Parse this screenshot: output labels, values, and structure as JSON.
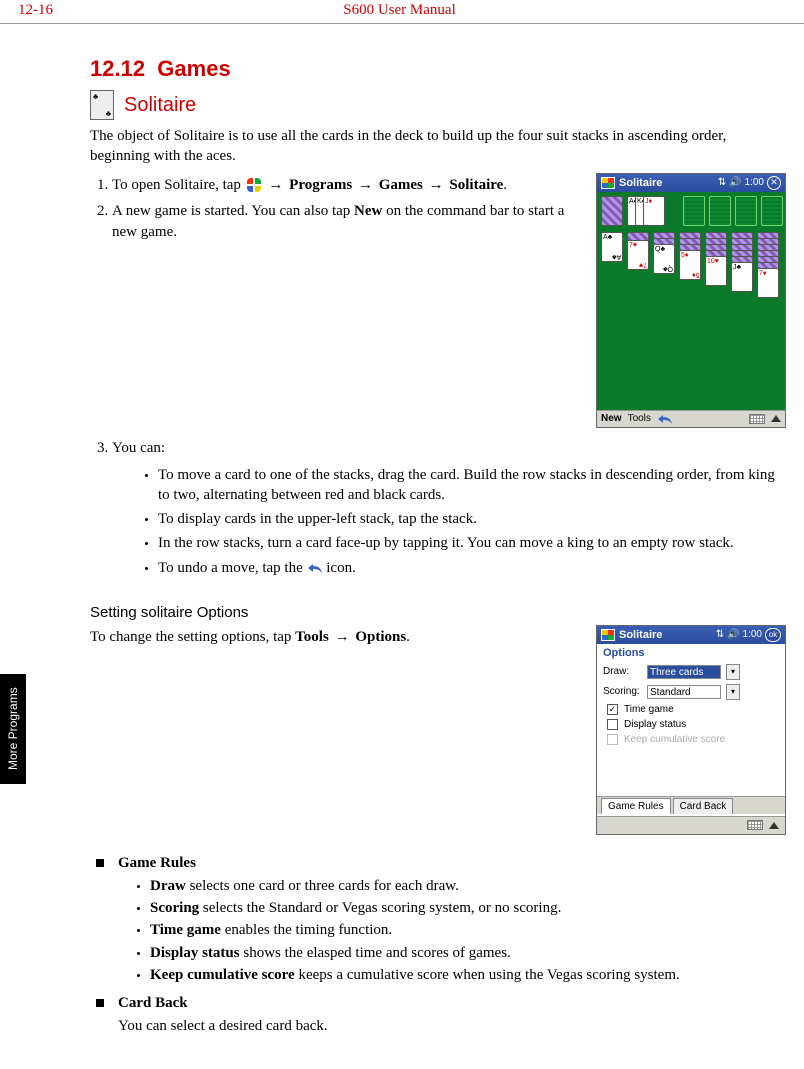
{
  "header": {
    "page_num": "12-16",
    "manual": "S600 User Manual"
  },
  "side_tab": "More Programs",
  "section_number": "12.12",
  "section_title": "Games",
  "game_title": "Solitaire",
  "intro": "The object of Solitaire is to use all the cards in the deck to build up the four suit stacks in ascending order, beginning with the aces.",
  "steps": {
    "s1a": "To open Solitaire, tap ",
    "s1_arrow": "→",
    "s1_b": "Programs",
    "s1_c": "Games",
    "s1_d": "Solitaire",
    "s2a": "A new game is started. You can also tap ",
    "s2_new": "New",
    "s2b": " on the command bar to start a new game.",
    "s3": "You can:",
    "s3_items": [
      "To move a card to one of the stacks, drag the card. Build the row stacks in descending order, from king to two, alternating between red and black cards.",
      "To display cards in the upper-left stack, tap the stack.",
      "In the row stacks, turn a card face-up by tapping it. You can move a king to an empty row stack."
    ],
    "s3_undo_a": "To undo a move, tap the ",
    "s3_undo_b": " icon."
  },
  "screenshot1": {
    "title": "Solitaire",
    "time": "1:00",
    "menu_new": "New",
    "menu_tools": "Tools"
  },
  "options_heading": "Setting solitaire Options",
  "options_intro_a": "To change the setting options, tap ",
  "options_intro_tools": "Tools",
  "options_intro_arrow": "→",
  "options_intro_options": "Options",
  "options_intro_end": ".",
  "screenshot2": {
    "title": "Solitaire",
    "time": "1:00",
    "ok": "ok",
    "subtitle": "Options",
    "draw_label": "Draw:",
    "draw_value": "Three cards",
    "scoring_label": "Scoring:",
    "scoring_value": "Standard",
    "chk_time": "Time game",
    "chk_display": "Display status",
    "chk_keep": "Keep cumulative score",
    "tab_rules": "Game Rules",
    "tab_back": "Card Back"
  },
  "rules_block_title": "Game Rules",
  "rules_items": [
    {
      "term": "Draw",
      "desc": "  selects one card or three cards for each draw."
    },
    {
      "term": "Scoring",
      "desc": "  selects the Standard or Vegas scoring system, or no scoring."
    },
    {
      "term": "Time game",
      "desc": "  enables the timing function."
    },
    {
      "term": "Display status",
      "desc": "  shows the elasped time and scores of games."
    },
    {
      "term": "Keep cumulative score",
      "desc": "  keeps a cumulative score when using the Vegas scoring system."
    }
  ],
  "cardback_title": "Card Back",
  "cardback_desc": "You can select a desired card back.",
  "chart_data": null
}
